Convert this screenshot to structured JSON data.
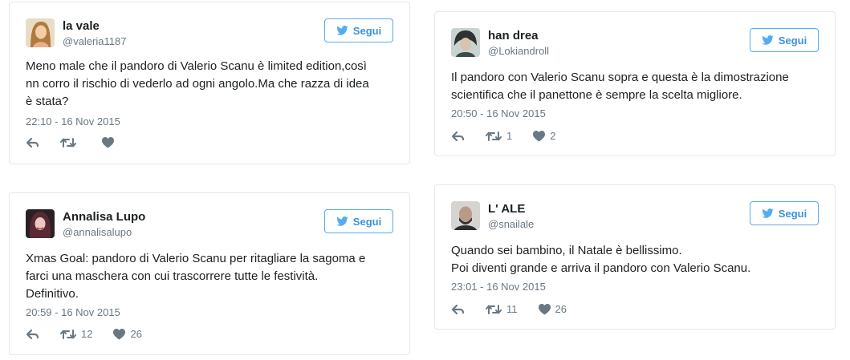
{
  "follow_label": "Segui",
  "accent_color": "#55acee",
  "tweets": [
    {
      "name": "la vale",
      "handle": "@valeria1187",
      "lines": [
        "Meno male che il pandoro di Valerio Scanu è limited edition,così",
        "nn corro il rischio di vederlo ad ogni angolo.Ma che razza di idea",
        "è stata?"
      ],
      "timestamp": "22:10 - 16 Nov 2015",
      "retweets": "",
      "likes": ""
    },
    {
      "name": "han drea",
      "handle": "@Lokiandroll",
      "lines": [
        "Il pandoro con Valerio Scanu sopra e questa è la dimostrazione",
        "scientifica che il panettone è sempre la scelta migliore."
      ],
      "timestamp": "20:50 - 16 Nov 2015",
      "retweets": "1",
      "likes": "2"
    },
    {
      "name": "Annalisa Lupo",
      "handle": "@annalisalupo",
      "lines": [
        "Xmas Goal: pandoro di Valerio Scanu per ritagliare la sagoma e",
        "farci una maschera con cui trascorrere tutte le festività.",
        "Definitivo."
      ],
      "timestamp": "20:59 - 16 Nov 2015",
      "retweets": "12",
      "likes": "26"
    },
    {
      "name": "L' ALE",
      "handle": "@snailale",
      "lines": [
        "Quando sei bambino, il Natale è bellissimo.",
        "Poi diventi grande e arriva il pandoro con Valerio Scanu."
      ],
      "timestamp": "23:01 - 16 Nov 2015",
      "retweets": "11",
      "likes": "26"
    }
  ]
}
